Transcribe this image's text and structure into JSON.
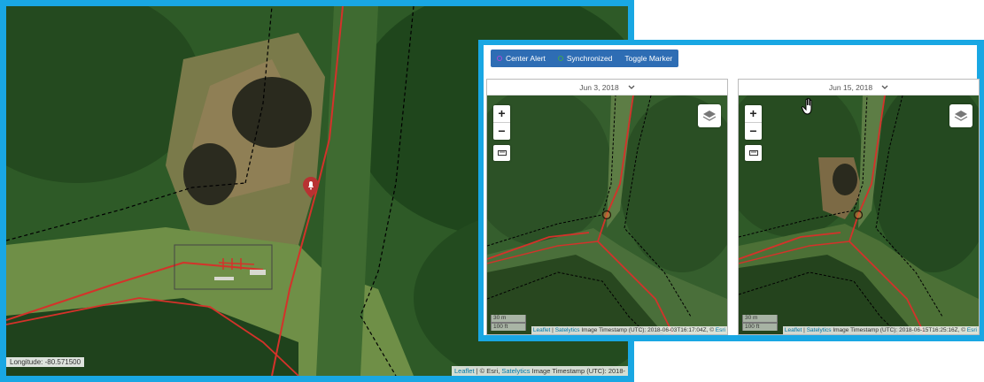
{
  "left_map": {
    "coordinate_text": "Longitude: -80.571500",
    "attribution": {
      "leaflet": "Leaflet",
      "sep1": " | © Esri, ",
      "satelytics": "Satelytics",
      "rest": " Image Timestamp (UTC): 2018-"
    }
  },
  "toolbar": {
    "center_alert": "Center Alert",
    "synchronized": "Synchronized",
    "toggle_marker": "Toggle Marker",
    "center_alert_color": "#a64ad6",
    "synchronized_color": "#3fa650"
  },
  "maps": [
    {
      "date": "Jun 3, 2018",
      "scale_m": "30 m",
      "scale_ft": "100 ft",
      "attr_leaflet": "Leaflet",
      "attr_sep": " | ",
      "attr_satelytics": "Satelytics",
      "attr_rest": " Image Timestamp (UTC): 2018-06-03T16:17:04Z, © ",
      "attr_esri": "Esri"
    },
    {
      "date": "Jun 15, 2018",
      "scale_m": "30 m",
      "scale_ft": "100 ft",
      "attr_leaflet": "Leaflet",
      "attr_sep": " | ",
      "attr_satelytics": "Satelytics",
      "attr_rest": " Image Timestamp (UTC): 2018-06-15T16:25:16Z, © ",
      "attr_esri": "Esri"
    }
  ],
  "controls": {
    "zoom_in": "+",
    "zoom_out": "−"
  },
  "colors": {
    "frame_accent": "#19a7e3",
    "pipeline": "#d4322a",
    "button_bar": "#2e6db4"
  }
}
